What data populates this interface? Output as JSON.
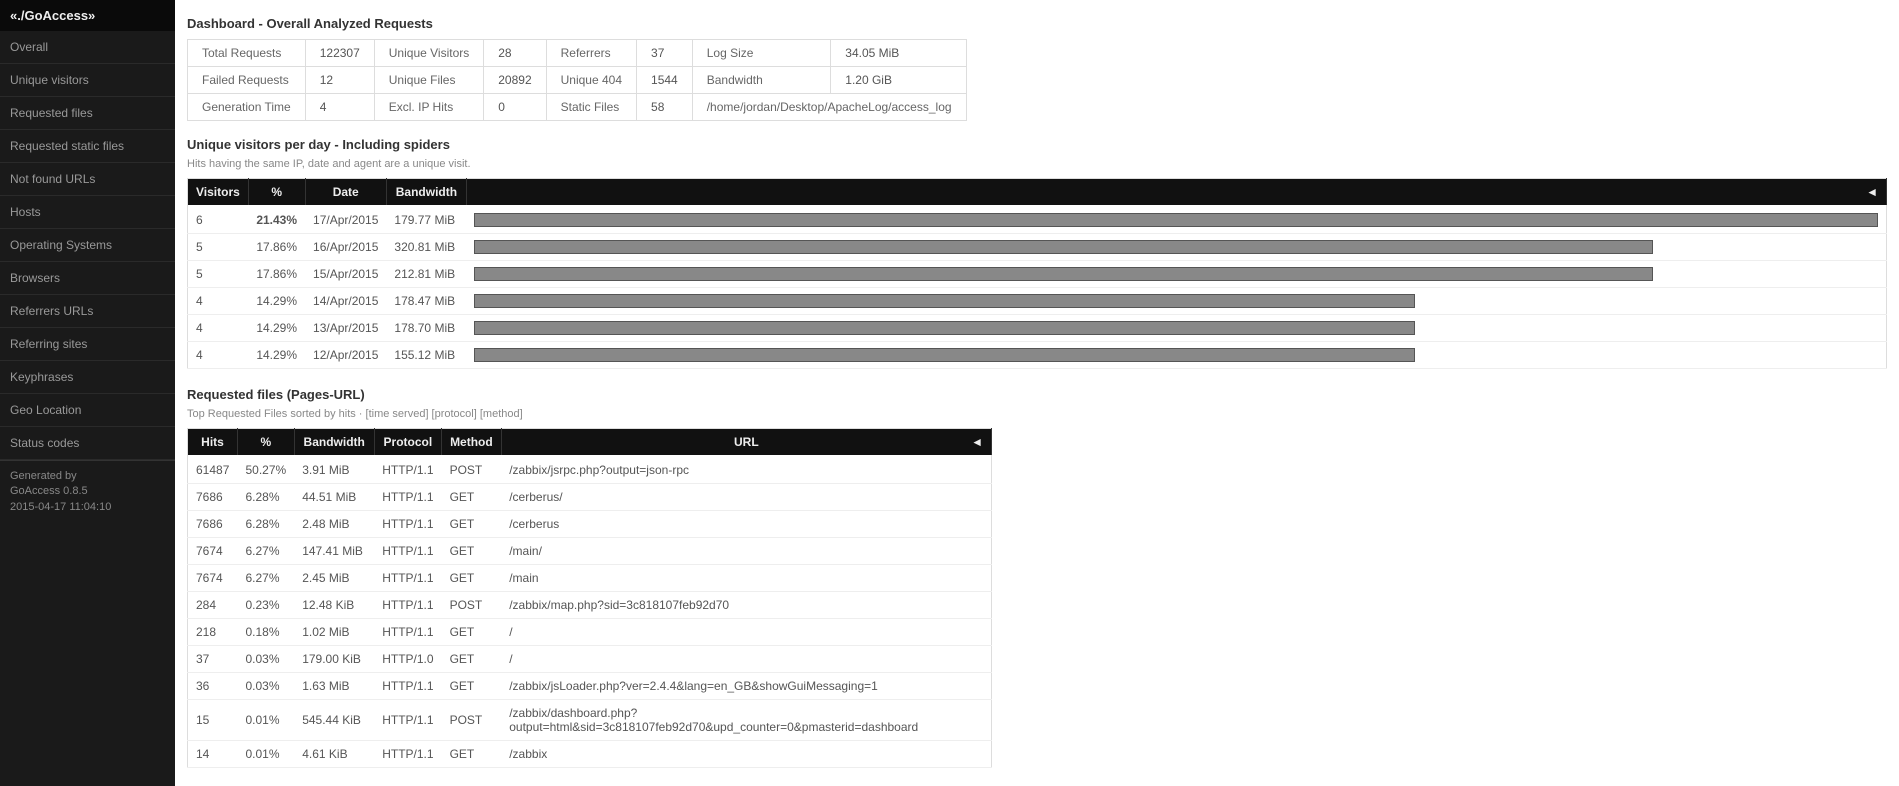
{
  "brand": "«./GoAccess»",
  "nav": [
    "Overall",
    "Unique visitors",
    "Requested files",
    "Requested static files",
    "Not found URLs",
    "Hosts",
    "Operating Systems",
    "Browsers",
    "Referrers URLs",
    "Referring sites",
    "Keyphrases",
    "Geo Location",
    "Status codes"
  ],
  "gen": {
    "by": "Generated by",
    "ver": "GoAccess 0.8.5",
    "ts": "2015-04-17 11:04:10"
  },
  "dash_title": "Dashboard - Overall Analyzed Requests",
  "overview": [
    [
      "Total Requests",
      "122307",
      "Unique Visitors",
      "28",
      "Referrers",
      "37",
      "Log Size",
      "34.05 MiB"
    ],
    [
      "Failed Requests",
      "12",
      "Unique Files",
      "20892",
      "Unique 404",
      "1544",
      "Bandwidth",
      "1.20 GiB"
    ],
    [
      "Generation Time",
      "4",
      "Excl. IP Hits",
      "0",
      "Static Files",
      "58",
      "/home/jordan/Desktop/ApacheLog/access_log",
      ""
    ]
  ],
  "visitors": {
    "title": "Unique visitors per day - Including spiders",
    "sub": "Hits having the same IP, date and agent are a unique visit.",
    "headers": [
      "Visitors",
      "%",
      "Date",
      "Bandwidth"
    ],
    "rows": [
      {
        "v": "6",
        "p": "21.43%",
        "d": "17/Apr/2015",
        "bw": "179.77 MiB",
        "barpct": 100,
        "hot": true
      },
      {
        "v": "5",
        "p": "17.86%",
        "d": "16/Apr/2015",
        "bw": "320.81 MiB",
        "barpct": 84
      },
      {
        "v": "5",
        "p": "17.86%",
        "d": "15/Apr/2015",
        "bw": "212.81 MiB",
        "barpct": 84
      },
      {
        "v": "4",
        "p": "14.29%",
        "d": "14/Apr/2015",
        "bw": "178.47 MiB",
        "barpct": 67
      },
      {
        "v": "4",
        "p": "14.29%",
        "d": "13/Apr/2015",
        "bw": "178.70 MiB",
        "barpct": 67
      },
      {
        "v": "4",
        "p": "14.29%",
        "d": "12/Apr/2015",
        "bw": "155.12 MiB",
        "barpct": 67
      }
    ]
  },
  "files": {
    "title": "Requested files (Pages-URL)",
    "sub": "Top Requested Files sorted by hits · [time served] [protocol] [method]",
    "headers": [
      "Hits",
      "%",
      "Bandwidth",
      "Protocol",
      "Method",
      "URL"
    ],
    "rows": [
      {
        "h": "61487",
        "p": "50.27%",
        "bw": "3.91 MiB",
        "pr": "HTTP/1.1",
        "m": "POST",
        "u": "/zabbix/jsrpc.php?output=json-rpc"
      },
      {
        "h": "7686",
        "p": "6.28%",
        "bw": "44.51 MiB",
        "pr": "HTTP/1.1",
        "m": "GET",
        "u": "/cerberus/"
      },
      {
        "h": "7686",
        "p": "6.28%",
        "bw": "2.48 MiB",
        "pr": "HTTP/1.1",
        "m": "GET",
        "u": "/cerberus"
      },
      {
        "h": "7674",
        "p": "6.27%",
        "bw": "147.41 MiB",
        "pr": "HTTP/1.1",
        "m": "GET",
        "u": "/main/"
      },
      {
        "h": "7674",
        "p": "6.27%",
        "bw": "2.45 MiB",
        "pr": "HTTP/1.1",
        "m": "GET",
        "u": "/main"
      },
      {
        "h": "284",
        "p": "0.23%",
        "bw": "12.48 KiB",
        "pr": "HTTP/1.1",
        "m": "POST",
        "u": "/zabbix/map.php?sid=3c818107feb92d70"
      },
      {
        "h": "218",
        "p": "0.18%",
        "bw": "1.02 MiB",
        "pr": "HTTP/1.1",
        "m": "GET",
        "u": "/"
      },
      {
        "h": "37",
        "p": "0.03%",
        "bw": "179.00 KiB",
        "pr": "HTTP/1.0",
        "m": "GET",
        "u": "/"
      },
      {
        "h": "36",
        "p": "0.03%",
        "bw": "1.63 MiB",
        "pr": "HTTP/1.1",
        "m": "GET",
        "u": "/zabbix/jsLoader.php?ver=2.4.4&lang=en_GB&showGuiMessaging=1"
      },
      {
        "h": "15",
        "p": "0.01%",
        "bw": "545.44 KiB",
        "pr": "HTTP/1.1",
        "m": "POST",
        "u": "/zabbix/dashboard.php?output=html&sid=3c818107feb92d70&upd_counter=0&pmasterid=dashboard"
      },
      {
        "h": "14",
        "p": "0.01%",
        "bw": "4.61 KiB",
        "pr": "HTTP/1.1",
        "m": "GET",
        "u": "/zabbix"
      }
    ]
  },
  "arrow": "◄"
}
